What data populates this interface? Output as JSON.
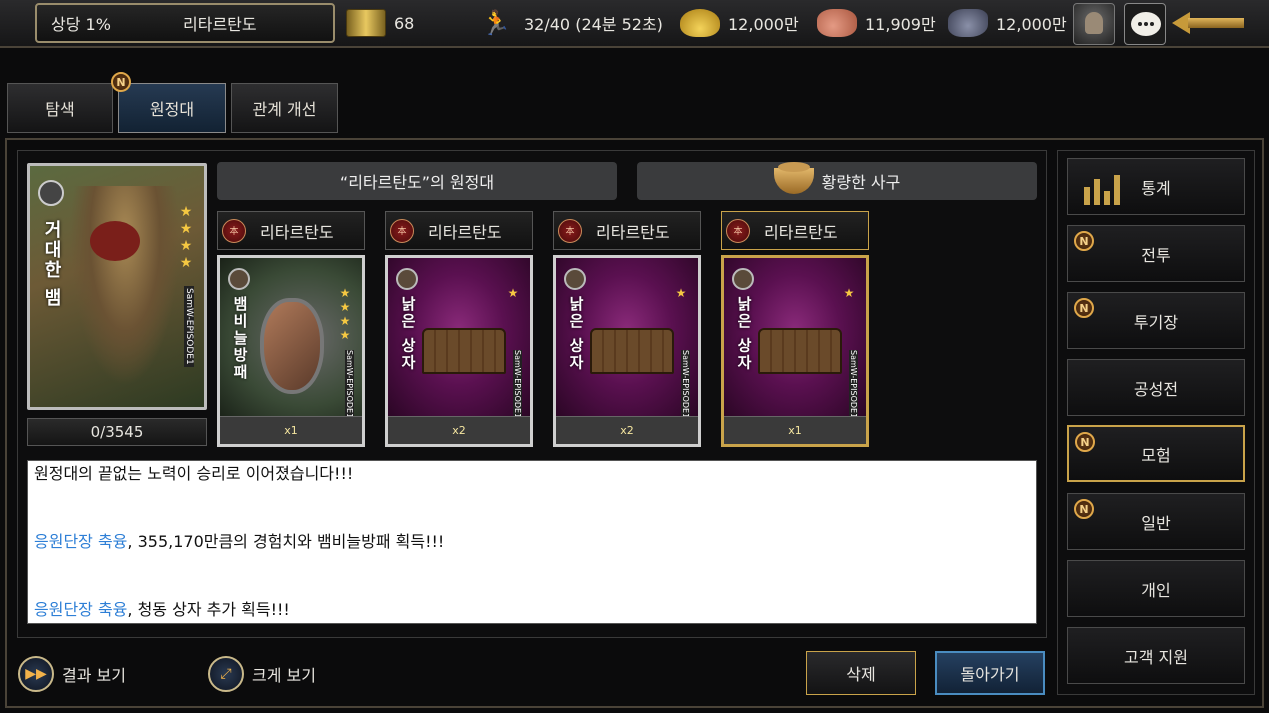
{
  "top": {
    "rank": "상당 1%",
    "player_name": "리타르탄도",
    "scrolls": "68",
    "stamina": "32/40 (24분 52초)",
    "gold": "12,000만",
    "food": "11,909만",
    "ore": "12,000만"
  },
  "tabs": [
    {
      "label": "탐색"
    },
    {
      "label": "원정대",
      "badge": "N"
    },
    {
      "label": "관계 개선"
    }
  ],
  "leader_card": {
    "name": "거대한 뱀",
    "stars": 4,
    "brand": "SamW-EPISODE1",
    "progress": "0/3545"
  },
  "party_title": "“리타르탄도”의 원정대",
  "location": "황량한 사구",
  "members": [
    {
      "name": "리타르탄도",
      "seal": "本"
    },
    {
      "name": "리타르탄도",
      "seal": "本"
    },
    {
      "name": "리타르탄도",
      "seal": "本"
    },
    {
      "name": "리타르탄도",
      "seal": "本"
    }
  ],
  "rewards": [
    {
      "name": "뱀비늘방패",
      "qty": "x1",
      "stars": 4,
      "brand": "SamW-EPISODE1"
    },
    {
      "name": "낡은 상자",
      "qty": "x2",
      "stars": 1,
      "brand": "SamW-EPISODE1"
    },
    {
      "name": "낡은 상자",
      "qty": "x2",
      "stars": 1,
      "brand": "SamW-EPISODE1"
    },
    {
      "name": "낡은 상자",
      "qty": "x1",
      "stars": 1,
      "brand": "SamW-EPISODE1"
    }
  ],
  "log": {
    "line1": "원정대의 끝없는 노력이 승리로 이어졌습니다!!!",
    "line2_name": "응원단장 축융",
    "line2_rest": ", 355,170만큼의 경험치와  뱀비늘방패 획득!!!",
    "line3_name": "응원단장 축융",
    "line3_rest": ", 청동 상자 추가 획득!!!"
  },
  "actions": {
    "result_view": "결과 보기",
    "zoom_view": "크게 보기",
    "delete": "삭제",
    "back": "돌아가기"
  },
  "side_menu": [
    {
      "label": "통계"
    },
    {
      "label": "전투",
      "badge": "N"
    },
    {
      "label": "투기장",
      "badge": "N"
    },
    {
      "label": "공성전"
    },
    {
      "label": "모험",
      "badge": "N"
    },
    {
      "label": "일반",
      "badge": "N"
    },
    {
      "label": "개인"
    },
    {
      "label": "고객 지원"
    }
  ],
  "colors": {
    "accent_gold": "#c9a34a",
    "highlight_blue": "#2e7fd6"
  }
}
